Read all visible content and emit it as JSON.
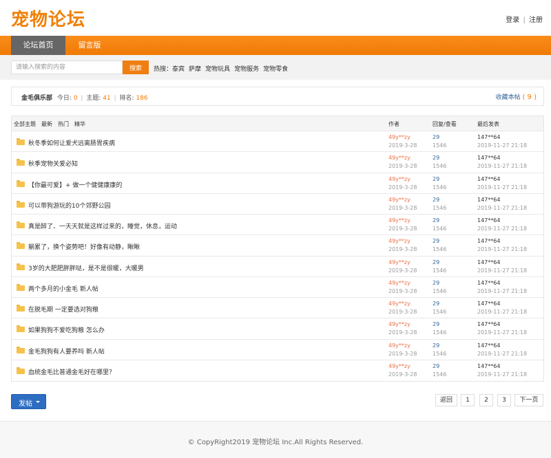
{
  "header": {
    "logo": "宠物论坛",
    "login": "登录",
    "separator": "|",
    "register": "注册"
  },
  "nav": {
    "items": [
      {
        "label": "论坛首页",
        "active": true
      },
      {
        "label": "留言版",
        "active": false
      }
    ]
  },
  "search": {
    "placeholder": "请输入搜索的内容",
    "button": "搜索",
    "hot_label": "热搜：",
    "hot_links": [
      "泰宾",
      "萨摩",
      "宠物玩具",
      "宠物服务",
      "宠物零食"
    ]
  },
  "info": {
    "club": "金毛俱乐部",
    "today_label": "今日:",
    "today": "0",
    "topics_label": "主题:",
    "topics": "41",
    "rank_label": "排名:",
    "rank": "186",
    "fav_label": "收藏本帖",
    "fav_count": "( 9 )"
  },
  "table": {
    "filters": [
      "全部主题",
      "最新",
      "热门",
      "精华"
    ],
    "col_author": "作者",
    "col_reply": "回复/查看",
    "col_last": "最后发表",
    "rows": [
      {
        "title": "秋冬季如何让爱犬远离肠胃疾病",
        "author": "49y**zy",
        "date": "2019-3-28",
        "replies": "29",
        "views": "1546",
        "last_user": "147**64",
        "last_time": "2019-11-27 21:18"
      },
      {
        "title": "秋季宠物关爱必知",
        "author": "49y**zy",
        "date": "2019-3-28",
        "replies": "29",
        "views": "1546",
        "last_user": "147**64",
        "last_time": "2019-11-27 21:18"
      },
      {
        "title": "【你最可爱】+ 做一个健健康康的",
        "author": "49y**zy",
        "date": "2019-3-28",
        "replies": "29",
        "views": "1546",
        "last_user": "147**64",
        "last_time": "2019-11-27 21:18"
      },
      {
        "title": "可以带狗游玩的10个郊野公园",
        "author": "49y**zy",
        "date": "2019-3-28",
        "replies": "29",
        "views": "1546",
        "last_user": "147**64",
        "last_time": "2019-11-27 21:18"
      },
      {
        "title": "真是醉了、一天天就是这样过来的，睡觉，休息，运动",
        "author": "49y**zy",
        "date": "2019-3-28",
        "replies": "29",
        "views": "1546",
        "last_user": "147**64",
        "last_time": "2019-11-27 21:18"
      },
      {
        "title": "躺累了，换个姿势吧！好像有动静，瞅瞅",
        "author": "49y**zy",
        "date": "2019-3-28",
        "replies": "29",
        "views": "1546",
        "last_user": "147**64",
        "last_time": "2019-11-27 21:18"
      },
      {
        "title": "3岁的大肥肥胖胖哒，是不是很暖，大暖男",
        "author": "49y**zy",
        "date": "2019-3-28",
        "replies": "29",
        "views": "1546",
        "last_user": "147**64",
        "last_time": "2019-11-27 21:18"
      },
      {
        "title": "两个多月的小金毛 新人帖",
        "author": "49y**zy",
        "date": "2019-3-28",
        "replies": "29",
        "views": "1546",
        "last_user": "147**64",
        "last_time": "2019-11-27 21:18"
      },
      {
        "title": "在脱毛期 一定要选对狗粮",
        "author": "49y**zy",
        "date": "2019-3-28",
        "replies": "29",
        "views": "1546",
        "last_user": "147**64",
        "last_time": "2019-11-27 21:18"
      },
      {
        "title": "如果狗狗不爱吃狗粮 怎么办",
        "author": "49y**zy",
        "date": "2019-3-28",
        "replies": "29",
        "views": "1546",
        "last_user": "147**64",
        "last_time": "2019-11-27 21:18"
      },
      {
        "title": "金毛狗狗有人要养吗 新人帖",
        "author": "49y**zy",
        "date": "2019-3-28",
        "replies": "29",
        "views": "1546",
        "last_user": "147**64",
        "last_time": "2019-11-27 21:18"
      },
      {
        "title": "血统金毛比普通金毛好在哪里？",
        "author": "49y**zy",
        "date": "2019-3-28",
        "replies": "29",
        "views": "1546",
        "last_user": "147**64",
        "last_time": "2019-11-27 21:18"
      }
    ]
  },
  "actions": {
    "post": "发帖"
  },
  "pager": {
    "prev": "返回",
    "pages": [
      "1",
      "2",
      "3"
    ],
    "next": "下一页"
  },
  "footer": {
    "copyright": "© CopyRight2019 宠物论坛 Inc.All Rights Reserved."
  }
}
